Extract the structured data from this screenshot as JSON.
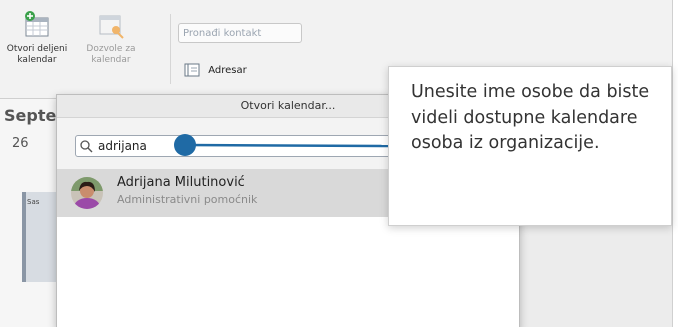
{
  "ribbon": {
    "open_shared_calendar": "Otvori deljeni kalendar",
    "calendar_permissions": "Dozvole za kalendar",
    "find_contact_placeholder": "Pronađi kontakt",
    "address_book": "Adresar"
  },
  "calendar": {
    "month_partial": "Septe",
    "day": "26",
    "event_partial": "Sas"
  },
  "dialog": {
    "title": "Otvori kalendar...",
    "search_value": "adrijana",
    "results": [
      {
        "name": "Adrijana Milutinović",
        "title": "Administrativni pomoćnik"
      }
    ]
  },
  "callout": {
    "text": "Unesite ime osobe da biste videli dostupne kalendare osoba iz organizacije."
  },
  "colors": {
    "pointer": "#1f6aa5",
    "accent_green": "#3aa04a"
  }
}
